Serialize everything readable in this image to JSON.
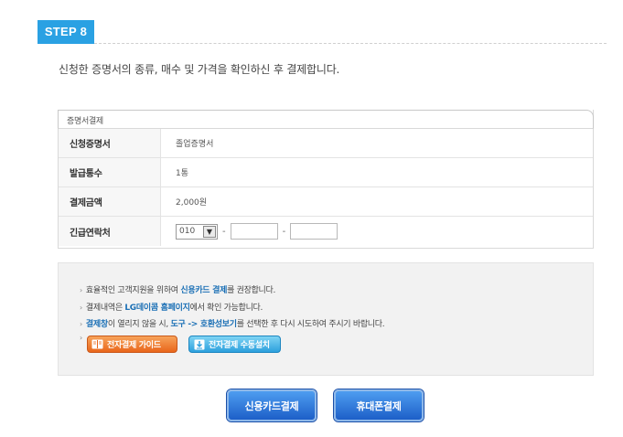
{
  "step": {
    "label": "STEP 8"
  },
  "instruction": "신청한 증명서의 종류, 매수 및 가격을 확인하신 후 결제합니다.",
  "payment": {
    "title": "증명서결제",
    "rows": [
      {
        "label": "신청증명서",
        "value": "졸업증명서"
      },
      {
        "label": "발급통수",
        "value": "1통"
      },
      {
        "label": "결제금액",
        "value": "2,000원"
      },
      {
        "label": "긴급연락처"
      }
    ],
    "phone": {
      "prefix": "010",
      "dash": "-"
    }
  },
  "notices": [
    {
      "pre": "효율적인 고객지원을 위하여 ",
      "hl": "신용카드 결제",
      "post": "를 권장합니다."
    },
    {
      "pre": "결제내역은 ",
      "hl": "LG데이콤 홈페이지",
      "post": "에서 확인 가능합니다."
    },
    {
      "hl1": "결제창",
      "mid1": "이 열리지 않을 시, ",
      "hl2": "도구 -> 호환성보기",
      "post": "를 선택한 후 다시 시도하여 주시기 바랍니다."
    }
  ],
  "guide_buttons": {
    "guide": "전자결제 가이드",
    "install": "전자결제 수동설치"
  },
  "buttons": {
    "credit_card": "신용카드결제",
    "mobile": "휴대폰결제"
  },
  "colors": {
    "accent": "#2aa1e3",
    "highlight": "#1a6fb5",
    "orange": "#e9661b",
    "button_blue": "#1d5fc8"
  }
}
